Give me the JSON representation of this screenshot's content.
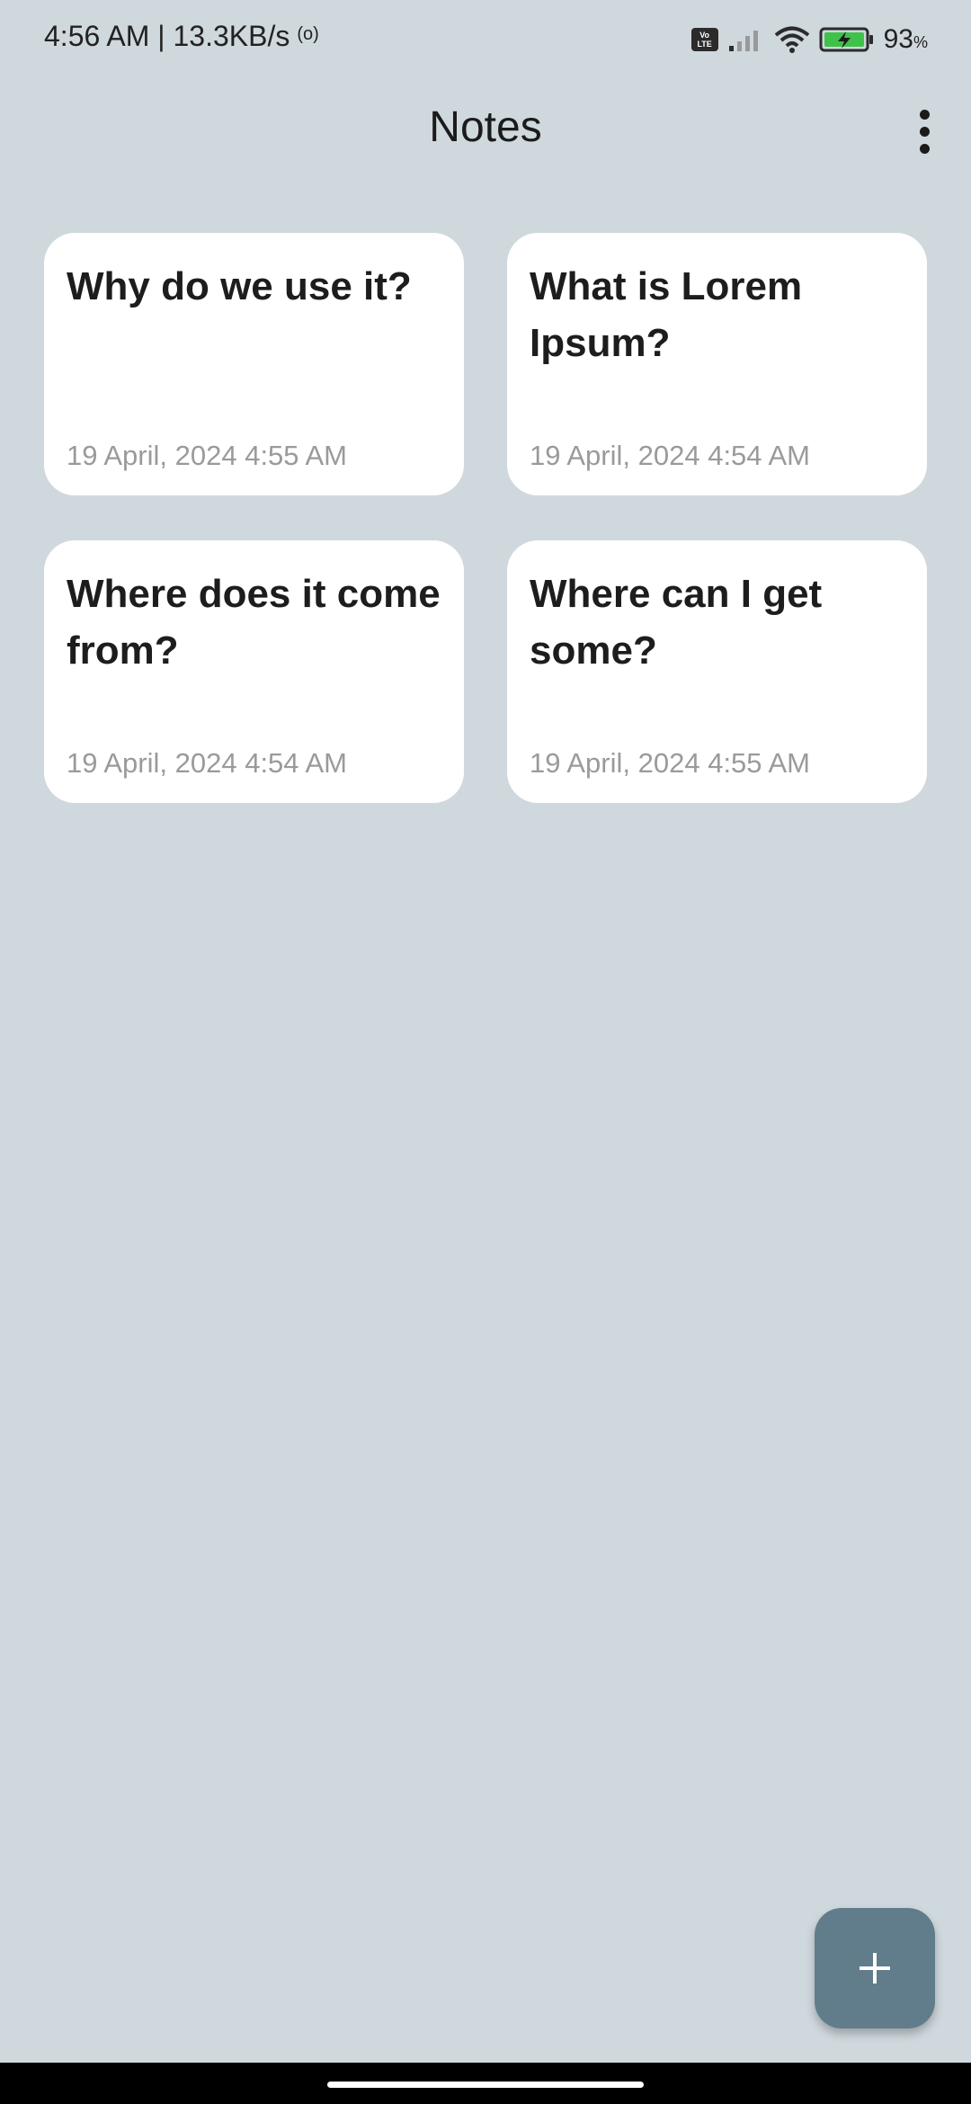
{
  "status_bar": {
    "time_network": "4:56 AM | 13.3KB/s",
    "hotspot_icon": "hotspot-icon",
    "volte": "Vo LTE",
    "battery_percent": "93",
    "battery_unit": "%"
  },
  "app_bar": {
    "title": "Notes",
    "menu_icon": "more-vert-icon"
  },
  "notes": [
    {
      "title": "Why do we use it?",
      "date": "19 April, 2024 4:55 AM"
    },
    {
      "title": "What is Lorem Ipsum?",
      "date": "19 April, 2024 4:54 AM"
    },
    {
      "title": "Where does it come from?",
      "date": "19 April, 2024 4:54 AM"
    },
    {
      "title": "Where can I get some?",
      "date": "19 April, 2024 4:55 AM"
    }
  ],
  "fab": {
    "icon": "plus-icon"
  },
  "colors": {
    "background": "#cfd8dd",
    "card": "#ffffff",
    "fab": "#617d8b",
    "date_text": "#9a9a9a"
  }
}
